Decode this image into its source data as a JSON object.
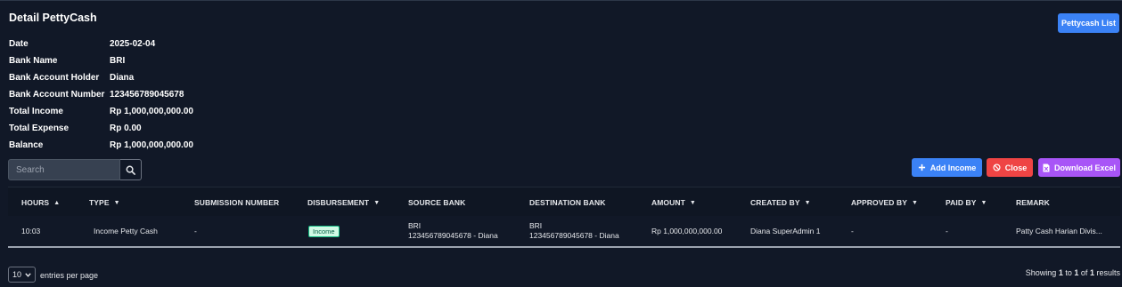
{
  "page": {
    "title": "Detail PettyCash",
    "list_button": "Pettycash List"
  },
  "info": [
    {
      "label": "Date",
      "value": "2025-02-04"
    },
    {
      "label": "Bank Name",
      "value": "BRI"
    },
    {
      "label": "Bank Account Holder",
      "value": "Diana"
    },
    {
      "label": "Bank Account Number",
      "value": "123456789045678"
    },
    {
      "label": "Total Income",
      "value": "Rp 1,000,000,000.00"
    },
    {
      "label": "Total Expense",
      "value": "Rp 0.00"
    },
    {
      "label": "Balance",
      "value": "Rp 1,000,000,000.00"
    }
  ],
  "search": {
    "placeholder": "Search"
  },
  "actions": {
    "add_income": "Add Income",
    "close": "Close",
    "download_excel": "Download Excel"
  },
  "table": {
    "headers": {
      "hours": "HOURS",
      "type": "TYPE",
      "submission_number": "SUBMISSION NUMBER",
      "disbursement": "DISBURSEMENT",
      "source_bank": "SOURCE BANK",
      "destination_bank": "DESTINATION BANK",
      "amount": "AMOUNT",
      "created_by": "CREATED BY",
      "approved_by": "APPROVED BY",
      "paid_by": "PAID BY",
      "remark": "REMARK"
    },
    "rows": [
      {
        "hours": "10:03",
        "type": "Income Petty Cash",
        "submission_number": "-",
        "disbursement": "Income",
        "source_bank_name": "BRI",
        "source_bank_account": "123456789045678 - Diana",
        "destination_bank_name": "BRI",
        "destination_bank_account": "123456789045678 - Diana",
        "amount": "Rp 1,000,000,000.00",
        "created_by": "Diana SuperAdmin 1",
        "approved_by": "-",
        "paid_by": "-",
        "remark": "Patty Cash Harian Divis..."
      }
    ]
  },
  "footer": {
    "per_page_value": "10",
    "per_page_label": "entries per page",
    "showing_prefix": "Showing",
    "showing_from": "1",
    "showing_to_word": "to",
    "showing_to": "1",
    "showing_of_word": "of",
    "showing_total": "1",
    "showing_suffix": "results"
  },
  "colors": {
    "background": "#111827",
    "primary": "#3b82f6",
    "danger": "#ef4444",
    "purple": "#a855f7",
    "badge_income": "#d1fae5"
  }
}
